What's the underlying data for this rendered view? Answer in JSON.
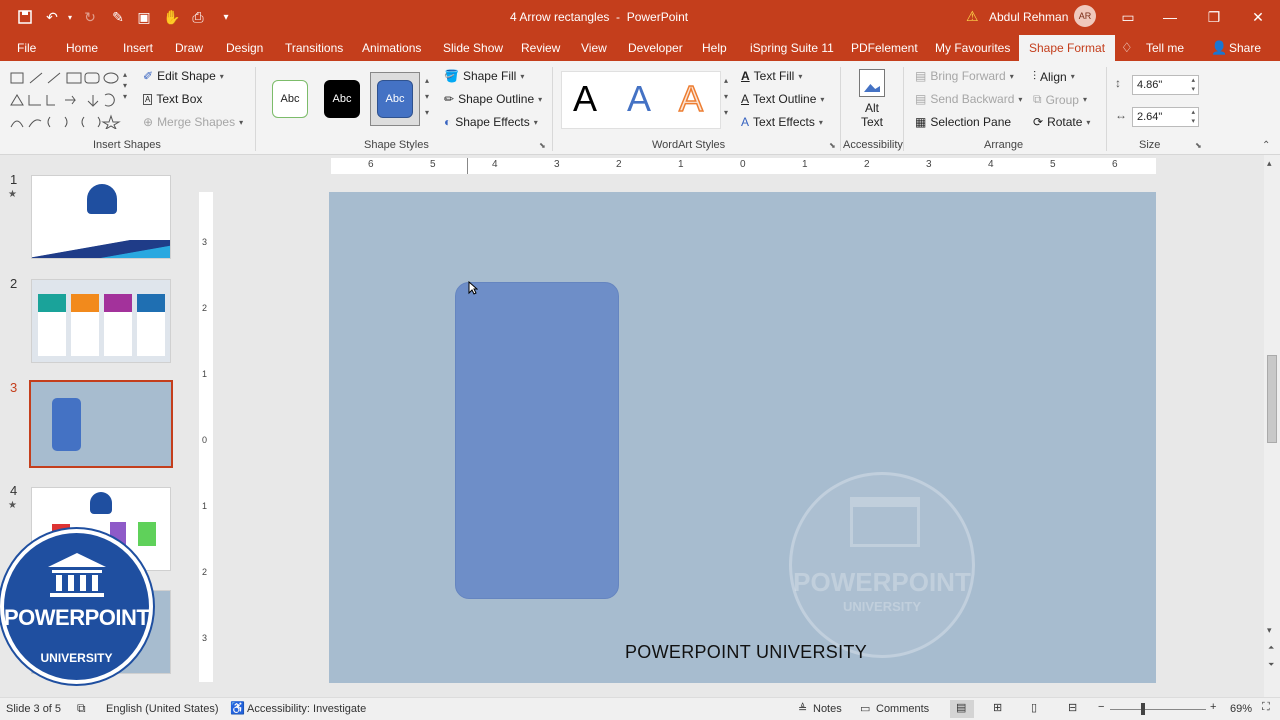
{
  "app": {
    "title": "4 Arrow rectangles  -  PowerPoint",
    "user_name": "Abdul Rehman",
    "user_initials": "AR"
  },
  "tabs": [
    {
      "label": "File"
    },
    {
      "label": "Home"
    },
    {
      "label": "Insert"
    },
    {
      "label": "Draw"
    },
    {
      "label": "Design"
    },
    {
      "label": "Transitions"
    },
    {
      "label": "Animations"
    },
    {
      "label": "Slide Show"
    },
    {
      "label": "Review"
    },
    {
      "label": "View"
    },
    {
      "label": "Developer"
    },
    {
      "label": "Help"
    },
    {
      "label": "iSpring Suite 11"
    },
    {
      "label": "PDFelement"
    },
    {
      "label": "My Favourites"
    },
    {
      "label": "Shape Format"
    }
  ],
  "tell_me": "Tell me",
  "share": "Share",
  "ribbon": {
    "insert_shapes": {
      "label": "Insert Shapes",
      "edit_shape": "Edit Shape",
      "text_box": "Text Box",
      "merge_shapes": "Merge Shapes"
    },
    "shape_styles": {
      "label": "Shape Styles",
      "style_sample": "Abc",
      "shape_fill": "Shape Fill",
      "shape_outline": "Shape Outline",
      "shape_effects": "Shape Effects"
    },
    "wordart": {
      "label": "WordArt Styles",
      "sample": "A",
      "text_fill": "Text Fill",
      "text_outline": "Text Outline",
      "text_effects": "Text Effects"
    },
    "accessibility": {
      "label": "Accessibility",
      "alt_text_1": "Alt",
      "alt_text_2": "Text"
    },
    "arrange": {
      "label": "Arrange",
      "bring_forward": "Bring Forward",
      "send_backward": "Send Backward",
      "selection_pane": "Selection Pane",
      "align": "Align",
      "group": "Group",
      "rotate": "Rotate"
    },
    "size": {
      "label": "Size",
      "height": "4.86\"",
      "width": "2.64\""
    }
  },
  "slides": [
    {
      "num": "1"
    },
    {
      "num": "2"
    },
    {
      "num": "3"
    },
    {
      "num": "4"
    }
  ],
  "ruler_h": [
    "6",
    "5",
    "4",
    "3",
    "2",
    "1",
    "0",
    "1",
    "2",
    "3",
    "4",
    "5",
    "6"
  ],
  "ruler_v": [
    "3",
    "2",
    "1",
    "0",
    "1",
    "2",
    "3"
  ],
  "slide": {
    "footer_text": "POWERPOINT UNIVERSITY",
    "watermark_1": "POWERPOINT",
    "watermark_2": "UNIVERSITY"
  },
  "logo": {
    "title": "POWERPOINT",
    "sub": "UNIVERSITY"
  },
  "status": {
    "slide_info": "Slide 3 of 5",
    "language": "English (United States)",
    "accessibility": "Accessibility: Investigate",
    "notes": "Notes",
    "comments": "Comments",
    "zoom": "69%"
  },
  "colors": {
    "accent": "#c43e1c",
    "slide_bg": "#a7bccf",
    "shape_fill": "#6e8ec8",
    "logo_blue": "#1f4fa0"
  }
}
